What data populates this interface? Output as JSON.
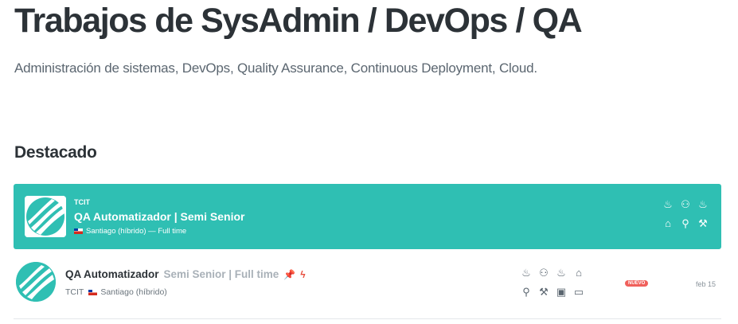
{
  "header": {
    "title": "Trabajos de SysAdmin / DevOps / QA",
    "subtitle": "Administración de sistemas, DevOps, Quality Assurance, Continuous Deployment, Cloud."
  },
  "featured": {
    "section_title": "Destacado",
    "company": "TCIT",
    "title": "QA Automatizador | Semi Senior",
    "location": "Santiago (híbrido)",
    "separator": " — ",
    "type": "Full time",
    "perk_icons": [
      "wellness-icon",
      "mentoring-icon",
      "meals-icon",
      "remote-icon",
      "bicycle-icon",
      "tools-icon"
    ],
    "colors": {
      "accent": "#2fbfb3"
    }
  },
  "listing": {
    "title": "QA Automatizador",
    "subtitle": "Semi Senior | Full time",
    "company": "TCIT",
    "location": "Santiago (híbrido)",
    "badge": "NUEVO",
    "date": "feb 15",
    "perk_icons": [
      "wellness-icon",
      "mentoring-icon",
      "meals-icon",
      "remote-icon",
      "bicycle-icon",
      "tools-icon",
      "transport-icon",
      "computer-icon"
    ],
    "status_icons": [
      "pin-icon",
      "bolt-icon"
    ],
    "colors": {
      "badge": "#f0605b",
      "pin": "#8e44ad",
      "bolt": "#e74c3c"
    }
  }
}
